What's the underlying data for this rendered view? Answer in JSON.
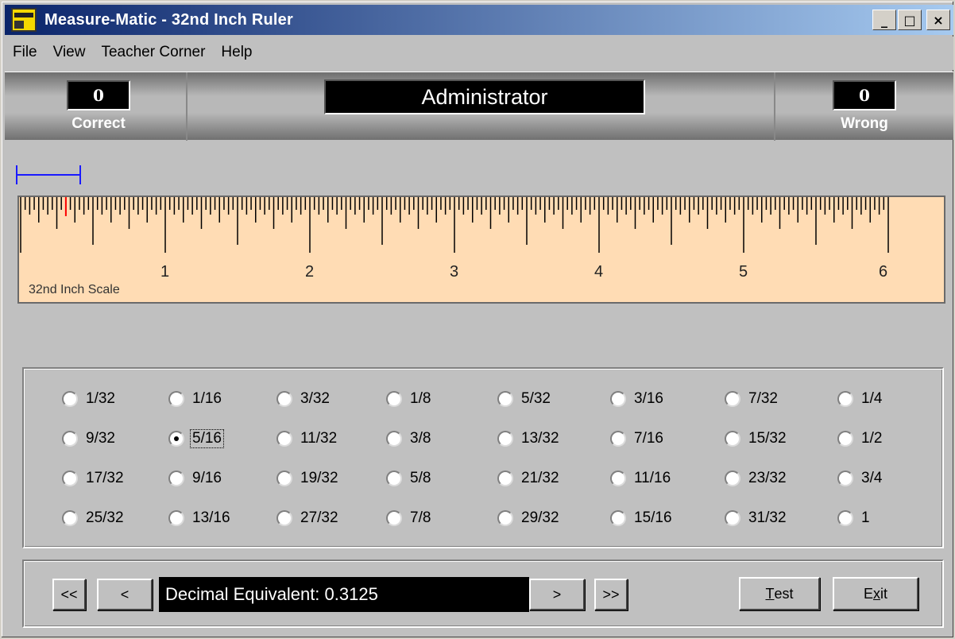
{
  "window": {
    "title": "Measure-Matic - 32nd Inch Ruler",
    "controls": {
      "minimize": "_",
      "maximize": "□",
      "close": "×"
    }
  },
  "menu": [
    "File",
    "View",
    "Teacher Corner",
    "Help"
  ],
  "score": {
    "correct_value": "0",
    "correct_label": "Correct",
    "user_name": "Administrator",
    "wrong_value": "0",
    "wrong_label": "Wrong"
  },
  "ruler": {
    "scale_label": "32nd Inch Scale",
    "inch_labels": [
      "1",
      "2",
      "3",
      "4",
      "5",
      "6"
    ],
    "divisions_per_inch": 32,
    "inches": 6,
    "marker_position_inches": 0.3125,
    "marker_color": "#ff0000",
    "bracket_color": "#1a1aff",
    "background": "#ffdcb4"
  },
  "options": [
    [
      "1/32",
      "1/16",
      "3/32",
      "1/8",
      "5/32",
      "3/16",
      "7/32",
      "1/4"
    ],
    [
      "9/32",
      "5/16",
      "11/32",
      "3/8",
      "13/32",
      "7/16",
      "15/32",
      "1/2"
    ],
    [
      "17/32",
      "9/16",
      "19/32",
      "5/8",
      "21/32",
      "11/16",
      "23/32",
      "3/4"
    ],
    [
      "25/32",
      "13/16",
      "27/32",
      "7/8",
      "29/32",
      "15/16",
      "31/32",
      "1"
    ]
  ],
  "selected_option": "5/16",
  "nav": {
    "first_label": "<<",
    "prev_label": "<",
    "decimal_text": "Decimal Equivalent: 0.3125",
    "next_label": ">",
    "last_label": ">>",
    "test_mnemonic": "T",
    "test_rest": "est",
    "exit_pre": "E",
    "exit_mnemonic": "x",
    "exit_post": "it"
  }
}
